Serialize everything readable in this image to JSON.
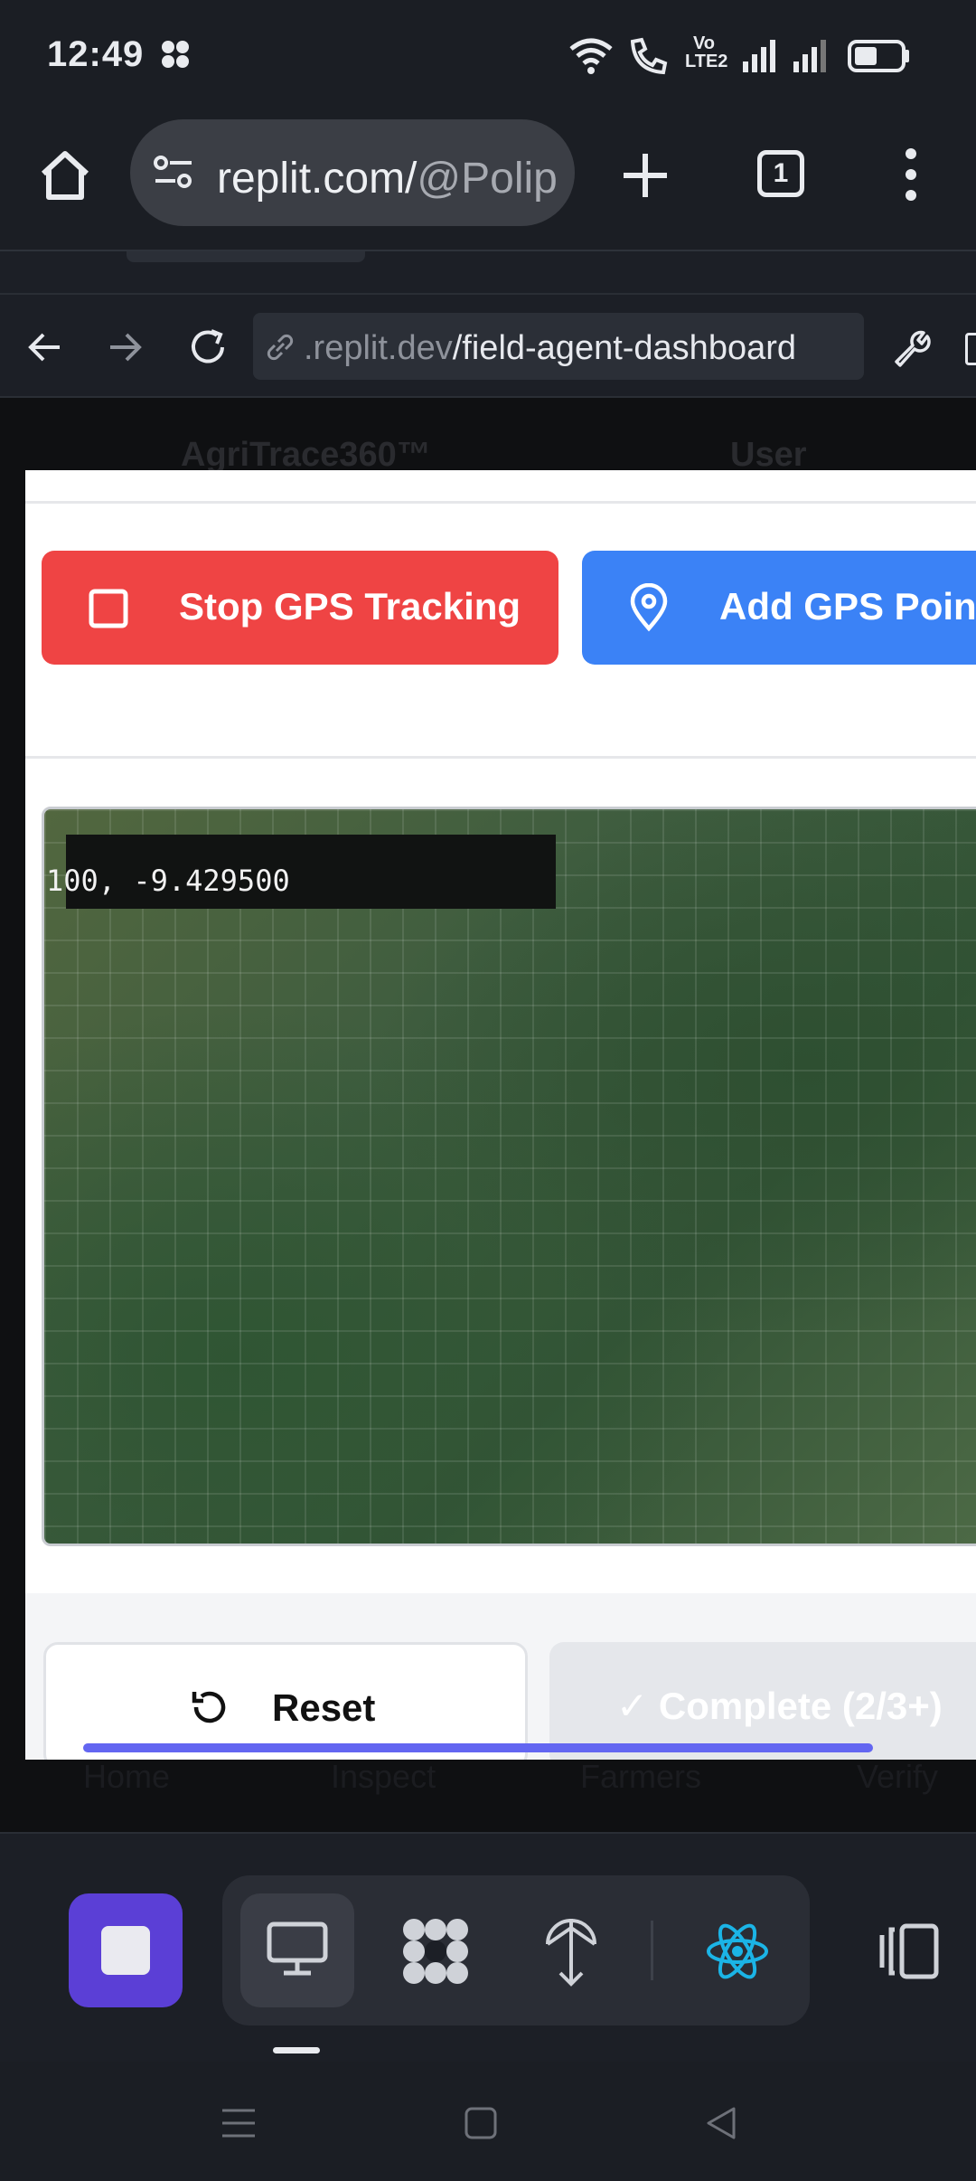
{
  "status_bar": {
    "time": "12:49",
    "network_label": "Vo LTE2"
  },
  "browser": {
    "address": {
      "host": "replit.com/",
      "path": "@Polip"
    },
    "tab_count": "1"
  },
  "webview": {
    "url_dim": ".replit.dev",
    "url_path": "/field-agent-dashboard"
  },
  "background_app": {
    "brand": "AgriTrace360™",
    "user_label": "User",
    "nav": [
      "Home",
      "Inspect",
      "Farmers",
      "Verify"
    ]
  },
  "modal": {
    "stop_button": "Stop GPS Tracking",
    "add_point_button": "Add GPS Point",
    "map_coordinates": "100, -9.429500",
    "reset_button": "Reset",
    "complete_button": "✓ Complete (2/3+)"
  },
  "colors": {
    "stop": "#ef4444",
    "add": "#3b82f6",
    "replit_stop": "#5b3fd6",
    "scroll": "#6366f1"
  },
  "icons": [
    "wifi-icon",
    "call-icon",
    "signal-icon",
    "battery-icon",
    "home-icon",
    "tune-icon",
    "plus-icon",
    "menu-icon",
    "back-icon",
    "forward-icon",
    "reload-icon",
    "link-icon",
    "wrench-icon",
    "square-stop-icon",
    "map-pin-icon",
    "reset-icon",
    "monitor-icon",
    "workflow-icon",
    "deploy-icon",
    "react-icon",
    "layout-icon"
  ]
}
